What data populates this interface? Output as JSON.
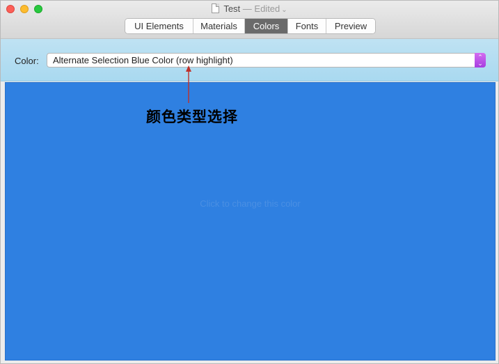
{
  "window": {
    "title": "Test",
    "title_suffix": "— Edited",
    "chevron": "⌄"
  },
  "tabs": [
    {
      "label": "UI Elements",
      "active": false
    },
    {
      "label": "Materials",
      "active": false
    },
    {
      "label": "Colors",
      "active": true
    },
    {
      "label": "Fonts",
      "active": false
    },
    {
      "label": "Preview",
      "active": false
    }
  ],
  "color_picker": {
    "label": "Color:",
    "selected": "Alternate Selection Blue Color (row highlight)"
  },
  "swatch": {
    "hint": "Click to change this color",
    "color": "#2f80e1"
  },
  "annotation": {
    "text": "颜色类型选择",
    "arrow_color": "#c0302a"
  }
}
